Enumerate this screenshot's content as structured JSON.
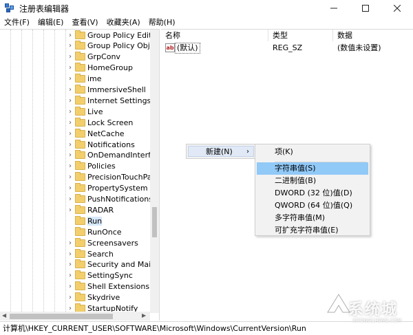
{
  "window": {
    "title": "注册表编辑器",
    "controls": [
      "minimize-icon",
      "maximize-icon",
      "close-icon"
    ]
  },
  "menubar": [
    "文件(F)",
    "编辑(E)",
    "查看(V)",
    "收藏夹(A)",
    "帮助(H)"
  ],
  "tree": {
    "items": [
      "Group Policy Editor",
      "Group Policy Objec",
      "GrpConv",
      "HomeGroup",
      "ime",
      "ImmersiveShell",
      "Internet Settings",
      "Live",
      "Lock Screen",
      "NetCache",
      "Notifications",
      "OnDemandInterface",
      "Policies",
      "PrecisionTouchPad",
      "PropertySystem",
      "PushNotifications",
      "RADAR",
      "Run",
      "RunOnce",
      "Screensavers",
      "Search",
      "Security and Mainte",
      "SettingSync",
      "Shell Extensions",
      "Skydrive",
      "StartupNotify"
    ],
    "selected": "Run",
    "no_expander": [
      "Run",
      "RunOnce"
    ]
  },
  "list": {
    "columns": [
      "名称",
      "类型",
      "数据"
    ],
    "rows": [
      {
        "name": "(默认)",
        "type": "REG_SZ",
        "data": "(数值未设置)"
      }
    ]
  },
  "context_menu": {
    "new_label": "新建(N)",
    "submenu": [
      "项(K)",
      "字符串值(S)",
      "二进制值(B)",
      "DWORD (32 位)值(D)",
      "QWORD (64 位)值(Q)",
      "多字符串值(M)",
      "可扩充字符串值(E)"
    ],
    "highlighted": "字符串值(S)"
  },
  "status_path": "计算机\\HKEY_CURRENT_USER\\SOFTWARE\\Microsoft\\Windows\\CurrentVersion\\Run",
  "watermark": {
    "text": "系统城",
    "sub": "XITONGCHENG.COM"
  },
  "colors": {
    "selection": "#91c9f7",
    "folder": "#f2cf6c",
    "menu_bg": "#f2f2f2"
  }
}
